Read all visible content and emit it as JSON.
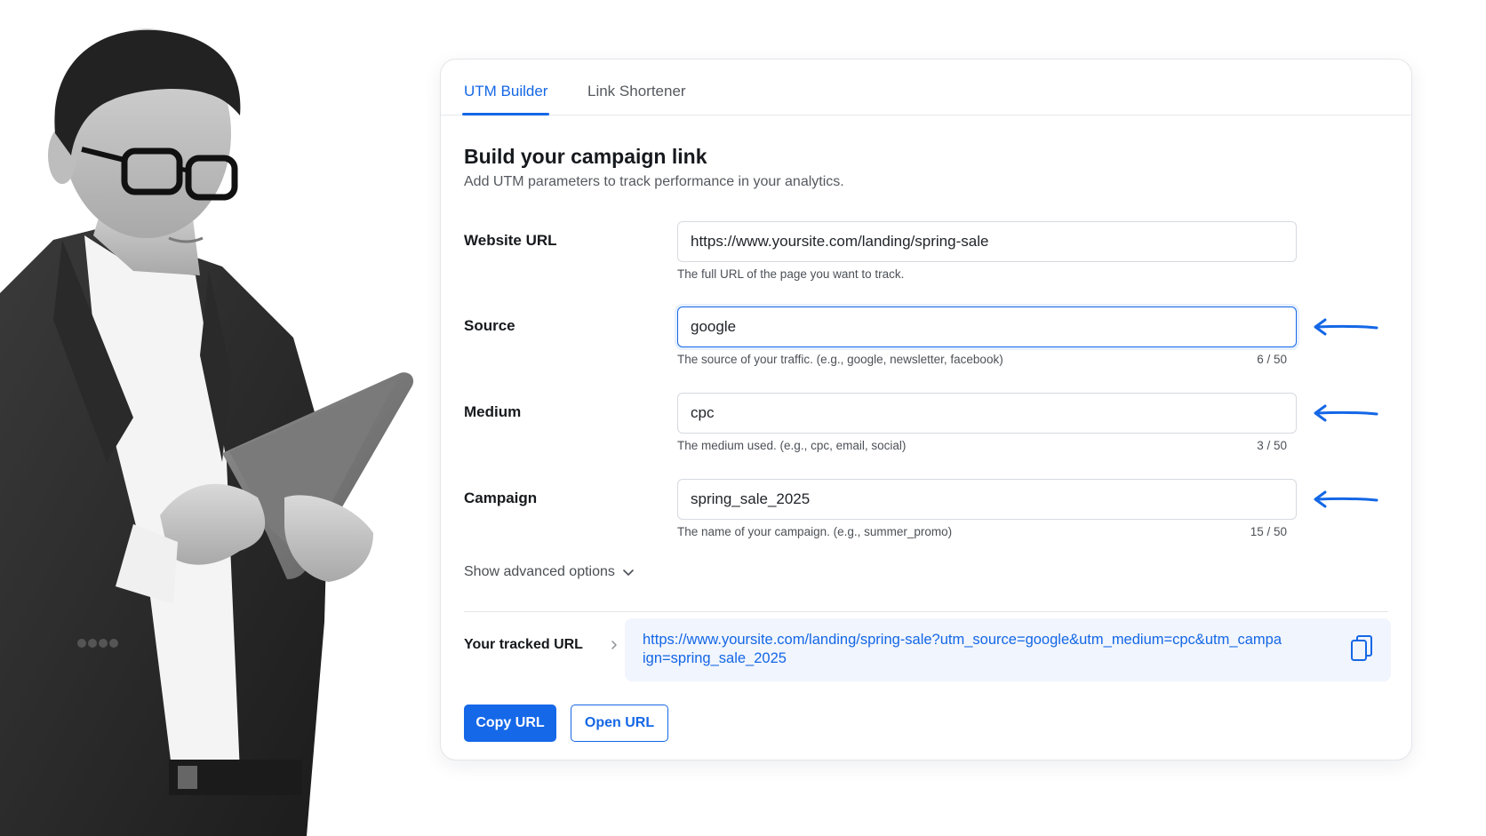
{
  "photo": {
    "description_icon": "person-holding-tablet"
  },
  "tabs": [
    {
      "label": "UTM Builder",
      "active": true
    },
    {
      "label": "Link Shortener",
      "active": false
    }
  ],
  "form": {
    "title": "Build your campaign link",
    "subtitle": "Add UTM parameters to track performance in your analytics.",
    "fields": [
      {
        "label": "Website URL",
        "value": "https://www.yoursite.com/landing/spring-sale",
        "help": "The full URL of the page you want to track.",
        "count": ""
      },
      {
        "label": "Source",
        "value": "google",
        "help": "The source of your traffic. (e.g., google, newsletter, facebook)",
        "count": "6 / 50"
      },
      {
        "label": "Medium",
        "value": "cpc",
        "help": "The medium used. (e.g., cpc, email, social)",
        "count": "3 / 50"
      },
      {
        "label": "Campaign",
        "value": "spring_sale_2025",
        "help": "The name of your campaign. (e.g., summer_promo)",
        "count": "15 / 50"
      }
    ],
    "advanced_label": "Show advanced options"
  },
  "tracked": {
    "label": "Your tracked URL",
    "url": "https://www.yoursite.com/landing/spring-sale?utm_source=google&utm_medium=cpc&utm_campaign=spring_sale_2025"
  },
  "actions": {
    "copy_label": "Copy URL",
    "open_label": "Open URL"
  },
  "colors": {
    "accent": "#1467e6",
    "tracked_bg": "#f1f5fd"
  }
}
